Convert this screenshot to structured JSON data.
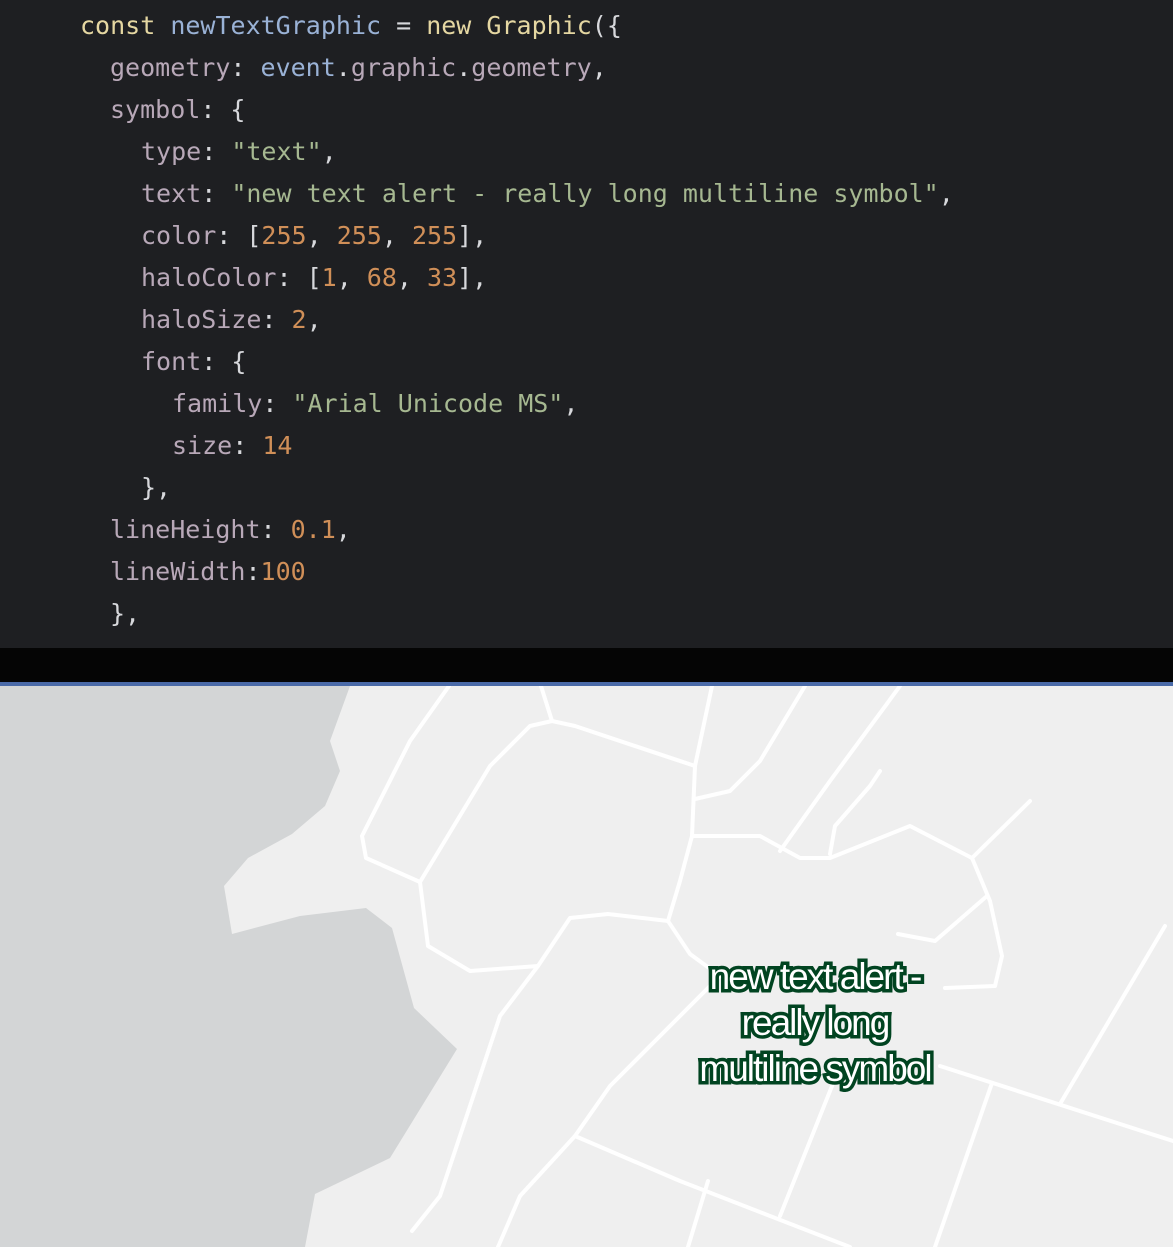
{
  "editor": {
    "lines": [
      [
        {
          "t": "const",
          "c": "kw"
        },
        {
          "t": " ",
          "c": "punc"
        },
        {
          "t": "newTextGraphic",
          "c": "var"
        },
        {
          "t": " = ",
          "c": "punc"
        },
        {
          "t": "new",
          "c": "kw"
        },
        {
          "t": " ",
          "c": "punc"
        },
        {
          "t": "Graphic",
          "c": "cls"
        },
        {
          "t": "({",
          "c": "punc"
        }
      ],
      [
        {
          "t": "geometry",
          "c": "prop"
        },
        {
          "t": ": ",
          "c": "punc"
        },
        {
          "t": "event",
          "c": "var"
        },
        {
          "t": ".",
          "c": "punc"
        },
        {
          "t": "graphic",
          "c": "prop"
        },
        {
          "t": ".",
          "c": "punc"
        },
        {
          "t": "geometry",
          "c": "prop"
        },
        {
          "t": ",",
          "c": "punc"
        }
      ],
      [
        {
          "t": "symbol",
          "c": "prop"
        },
        {
          "t": ": {",
          "c": "punc"
        }
      ],
      [
        {
          "t": "type",
          "c": "prop"
        },
        {
          "t": ": ",
          "c": "punc"
        },
        {
          "t": "\"text\"",
          "c": "str"
        },
        {
          "t": ",",
          "c": "punc"
        }
      ],
      [
        {
          "t": "text",
          "c": "prop"
        },
        {
          "t": ": ",
          "c": "punc"
        },
        {
          "t": "\"new text alert - really long multiline symbol\"",
          "c": "str"
        },
        {
          "t": ",",
          "c": "punc"
        }
      ],
      [
        {
          "t": "color",
          "c": "prop"
        },
        {
          "t": ": [",
          "c": "punc"
        },
        {
          "t": "255",
          "c": "num"
        },
        {
          "t": ", ",
          "c": "punc"
        },
        {
          "t": "255",
          "c": "num"
        },
        {
          "t": ", ",
          "c": "punc"
        },
        {
          "t": "255",
          "c": "num"
        },
        {
          "t": "],",
          "c": "punc"
        }
      ],
      [
        {
          "t": "haloColor",
          "c": "prop"
        },
        {
          "t": ": [",
          "c": "punc"
        },
        {
          "t": "1",
          "c": "num"
        },
        {
          "t": ", ",
          "c": "punc"
        },
        {
          "t": "68",
          "c": "num"
        },
        {
          "t": ", ",
          "c": "punc"
        },
        {
          "t": "33",
          "c": "num"
        },
        {
          "t": "],",
          "c": "punc"
        }
      ],
      [
        {
          "t": "haloSize",
          "c": "prop"
        },
        {
          "t": ": ",
          "c": "punc"
        },
        {
          "t": "2",
          "c": "num"
        },
        {
          "t": ",",
          "c": "punc"
        }
      ],
      [
        {
          "t": "font",
          "c": "prop"
        },
        {
          "t": ": {",
          "c": "punc"
        }
      ],
      [
        {
          "t": "family",
          "c": "prop"
        },
        {
          "t": ": ",
          "c": "punc"
        },
        {
          "t": "\"Arial Unicode MS\"",
          "c": "str"
        },
        {
          "t": ",",
          "c": "punc"
        }
      ],
      [
        {
          "t": "size",
          "c": "prop"
        },
        {
          "t": ": ",
          "c": "punc"
        },
        {
          "t": "14",
          "c": "num"
        }
      ],
      [
        {
          "t": "},",
          "c": "punc"
        }
      ],
      [
        {
          "t": "lineHeight",
          "c": "prop"
        },
        {
          "t": ": ",
          "c": "punc"
        },
        {
          "t": "0.1",
          "c": "num"
        },
        {
          "t": ",",
          "c": "punc"
        }
      ],
      [
        {
          "t": "lineWidth",
          "c": "prop"
        },
        {
          "t": ":",
          "c": "punc"
        },
        {
          "t": "100",
          "c": "num"
        }
      ],
      [
        {
          "t": "},",
          "c": "punc"
        }
      ]
    ]
  },
  "map": {
    "label_lines": [
      "new text alert -",
      "really long",
      "multiline symbol"
    ],
    "colors": {
      "background": "#efefef",
      "water": "#d3d5d6",
      "roads": "#ffffff",
      "halo": "#014421",
      "text": "#ffffff"
    }
  }
}
